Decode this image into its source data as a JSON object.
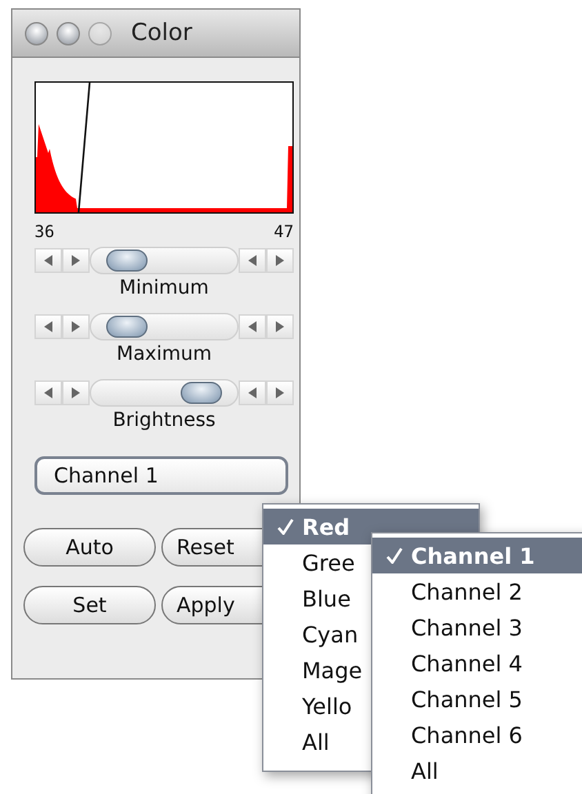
{
  "window": {
    "title": "Color",
    "close_enabled": true,
    "minimize_enabled": true,
    "zoom_enabled": false
  },
  "histogram": {
    "min_label": "36",
    "max_label": "47"
  },
  "sliders": [
    {
      "label": "Minimum",
      "level": 0.15
    },
    {
      "label": "Maximum",
      "level": 0.15
    },
    {
      "label": "Brightness",
      "level": 0.85
    }
  ],
  "channel_select": {
    "value": "Channel 1"
  },
  "buttons": [
    "Auto",
    "Reset",
    "Set",
    "Apply"
  ],
  "color_menu": [
    {
      "label": "Red",
      "selected": true
    },
    {
      "label": "Gree",
      "selected": false
    },
    {
      "label": "Blue",
      "selected": false
    },
    {
      "label": "Cyan",
      "selected": false
    },
    {
      "label": "Mage",
      "selected": false
    },
    {
      "label": "Yello",
      "selected": false
    },
    {
      "label": "All",
      "selected": false
    }
  ],
  "channel_menu": [
    {
      "label": "Channel 1",
      "selected": true
    },
    {
      "label": "Channel 2",
      "selected": false
    },
    {
      "label": "Channel 3",
      "selected": false
    },
    {
      "label": "Channel 4",
      "selected": false
    },
    {
      "label": "Channel 5",
      "selected": false
    },
    {
      "label": "Channel 6",
      "selected": false
    },
    {
      "label": "All",
      "selected": false
    }
  ]
}
